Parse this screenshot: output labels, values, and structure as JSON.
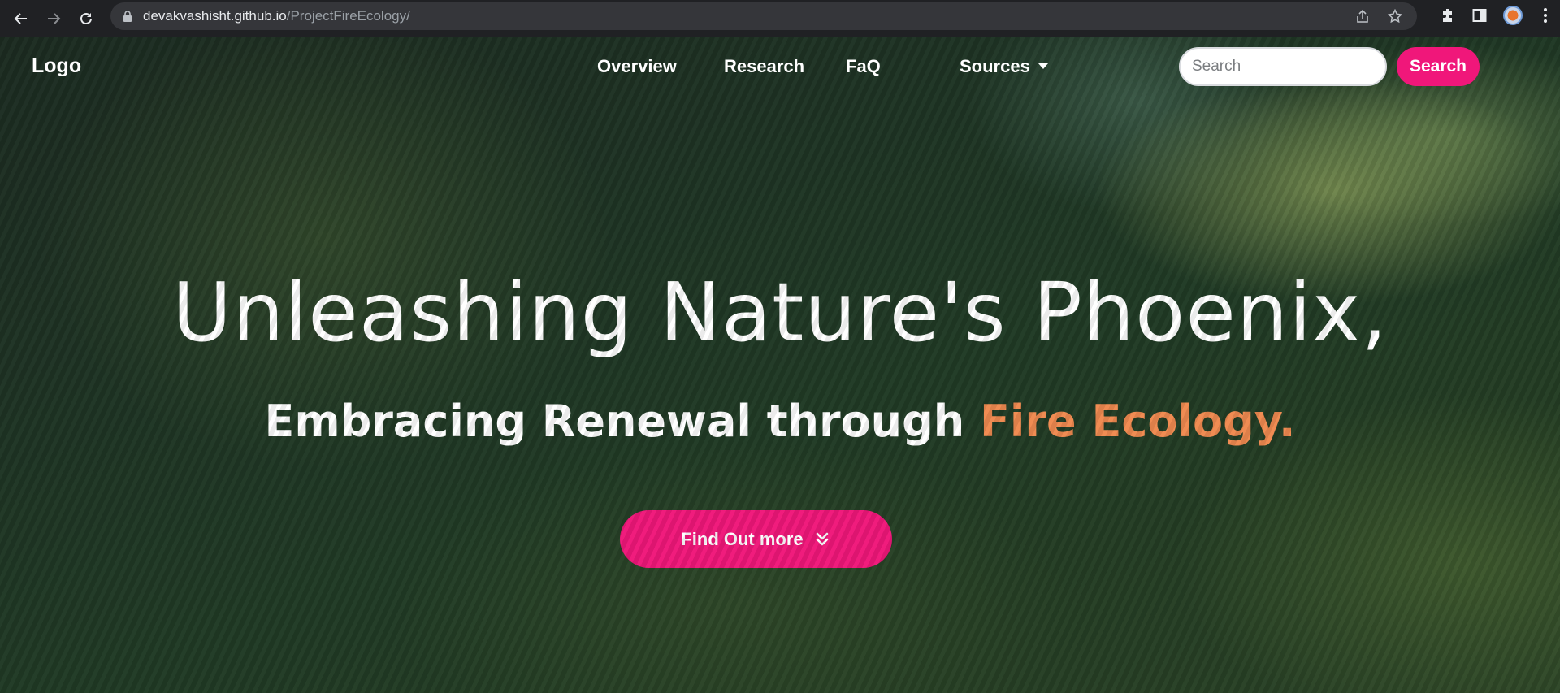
{
  "browser": {
    "url_host": "devakvashisht.github.io",
    "url_path": "/ProjectFireEcology/"
  },
  "site": {
    "logo": "Logo",
    "nav": {
      "overview": "Overview",
      "research": "Research",
      "faq": "FaQ",
      "sources": "Sources"
    },
    "search": {
      "placeholder": "Search",
      "button_label": "Search"
    }
  },
  "hero": {
    "headline": "Unleashing Nature's Phoenix,",
    "subheadline_main": "Embracing Renewal through ",
    "subheadline_accent": "Fire Ecology.",
    "cta_label": "Find Out more",
    "accent_color": "#f08a50",
    "button_color": "#f0177a"
  },
  "icons": [
    "back-arrow-icon",
    "forward-arrow-icon",
    "reload-icon",
    "lock-icon",
    "share-icon",
    "star-icon",
    "extensions-icon",
    "side-panel-icon",
    "profile-avatar",
    "menu-icon",
    "caret-down-icon",
    "double-chevron-down-icon"
  ]
}
